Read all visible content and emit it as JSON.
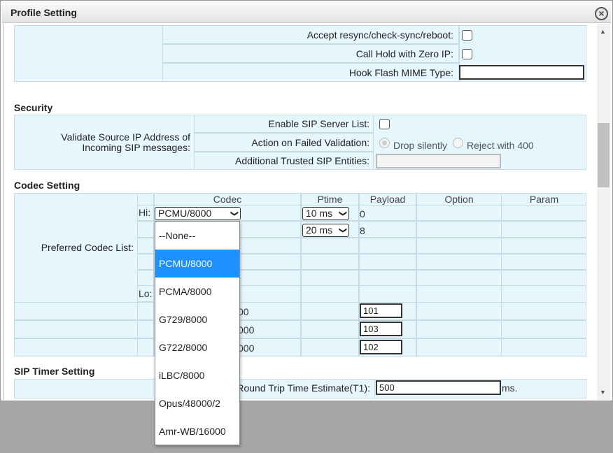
{
  "dialog": {
    "title": "Profile Setting"
  },
  "sip_options": {
    "accept_resync_label": "Accept resync/check-sync/reboot:",
    "call_hold_zero_ip_label": "Call Hold with Zero IP:",
    "hook_flash_mime_label": "Hook Flash MIME Type:",
    "hook_flash_mime_value": ""
  },
  "security": {
    "heading": "Security",
    "validate_source_label_line1": "Validate Source IP Address of",
    "validate_source_label_line2": "Incoming SIP messages:",
    "enable_server_list_label": "Enable SIP Server List:",
    "action_failed_label": "Action on Failed Validation:",
    "drop_silently_label": "Drop silently",
    "reject_400_label": "Reject with 400",
    "additional_trusted_label": "Additional Trusted SIP Entities:",
    "additional_trusted_value": ""
  },
  "codec": {
    "heading": "Codec Setting",
    "preferred_label": "Preferred Codec List:",
    "col_codec": "Codec",
    "col_ptime": "Ptime",
    "col_payload": "Payload",
    "col_option": "Option",
    "col_param": "Param",
    "hi_label": "Hi:",
    "lo_label": "Lo:",
    "row1_codec": "PCMU/8000",
    "row1_ptime": "10 ms",
    "row1_payload": "0",
    "row2_ptime": "20 ms",
    "row2_payload": "8",
    "dyn_row1_suffix": "00",
    "dyn_row1_payload": "101",
    "dyn_row2_suffix": "000",
    "dyn_row2_payload": "103",
    "dyn_row3_suffix": "000",
    "dyn_row3_payload": "102",
    "dropdown_options": [
      "--None--",
      "PCMU/8000",
      "PCMA/8000",
      "G729/8000",
      "G722/8000",
      "iLBC/8000",
      "Opus/48000/2",
      "Amr-WB/16000"
    ]
  },
  "sip_timer": {
    "heading": "SIP Timer Setting",
    "t1_label": "Round Trip Time Estimate(T1):",
    "t1_value": "500",
    "t1_unit": "ms."
  }
}
